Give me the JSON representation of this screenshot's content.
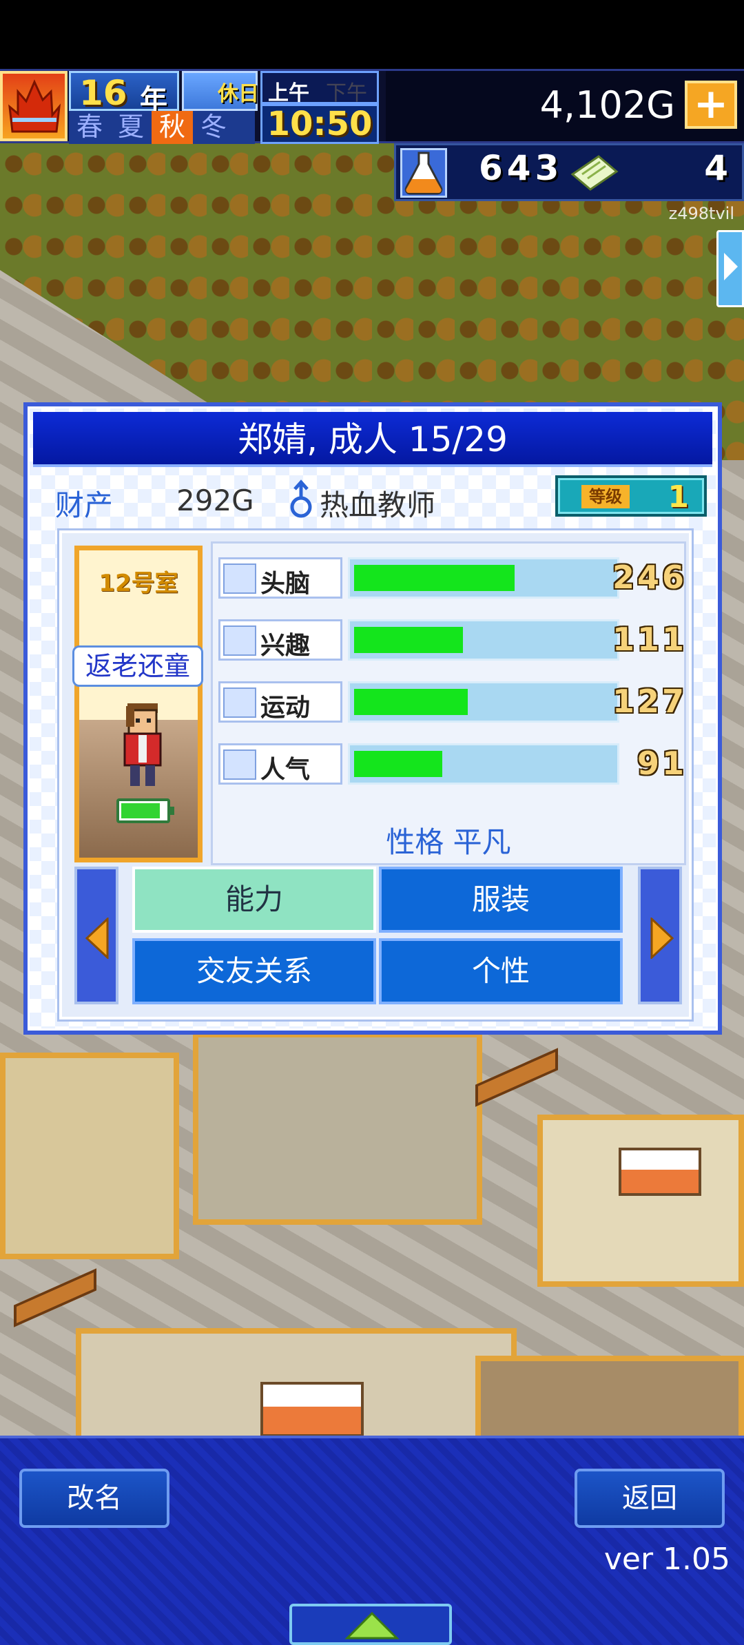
{
  "top_bar": {
    "year_number": "16",
    "year_unit": "年",
    "day_type": "休日",
    "am_label": "上午",
    "pm_label": "下午",
    "time": "10:50",
    "seasons": [
      "春",
      "夏",
      "秋",
      "冬"
    ],
    "active_season": "秋",
    "money": "4,102G",
    "research_points": "643",
    "tickets": "4",
    "user_id": "z498tvil"
  },
  "dialog": {
    "title": "郑婧, 成人 15/29",
    "property_label": "财产",
    "property_value": "292G",
    "job": "热血教师",
    "level_label": "等级",
    "level_value": "1",
    "room": "12号室",
    "trait": "返老还童",
    "stats": [
      {
        "name": "头脑",
        "value": "246",
        "fill": 0.62,
        "icon": "brain-icon"
      },
      {
        "name": "兴趣",
        "value": "111",
        "fill": 0.42,
        "icon": "interest-icon"
      },
      {
        "name": "运动",
        "value": "127",
        "fill": 0.44,
        "icon": "sport-icon"
      },
      {
        "name": "人气",
        "value": "91",
        "fill": 0.34,
        "icon": "popularity-icon"
      }
    ],
    "personality": "性格 平凡",
    "tabs": [
      "能力",
      "服装",
      "交友关系",
      "个性"
    ],
    "active_tab": "能力"
  },
  "bottom_bar": {
    "rename_label": "改名",
    "back_label": "返回",
    "version": "ver 1.05"
  },
  "colors": {
    "stat_bar": "#14e51c",
    "title_bar": "#0d2bd6",
    "accent_orange": "#f5a623"
  }
}
